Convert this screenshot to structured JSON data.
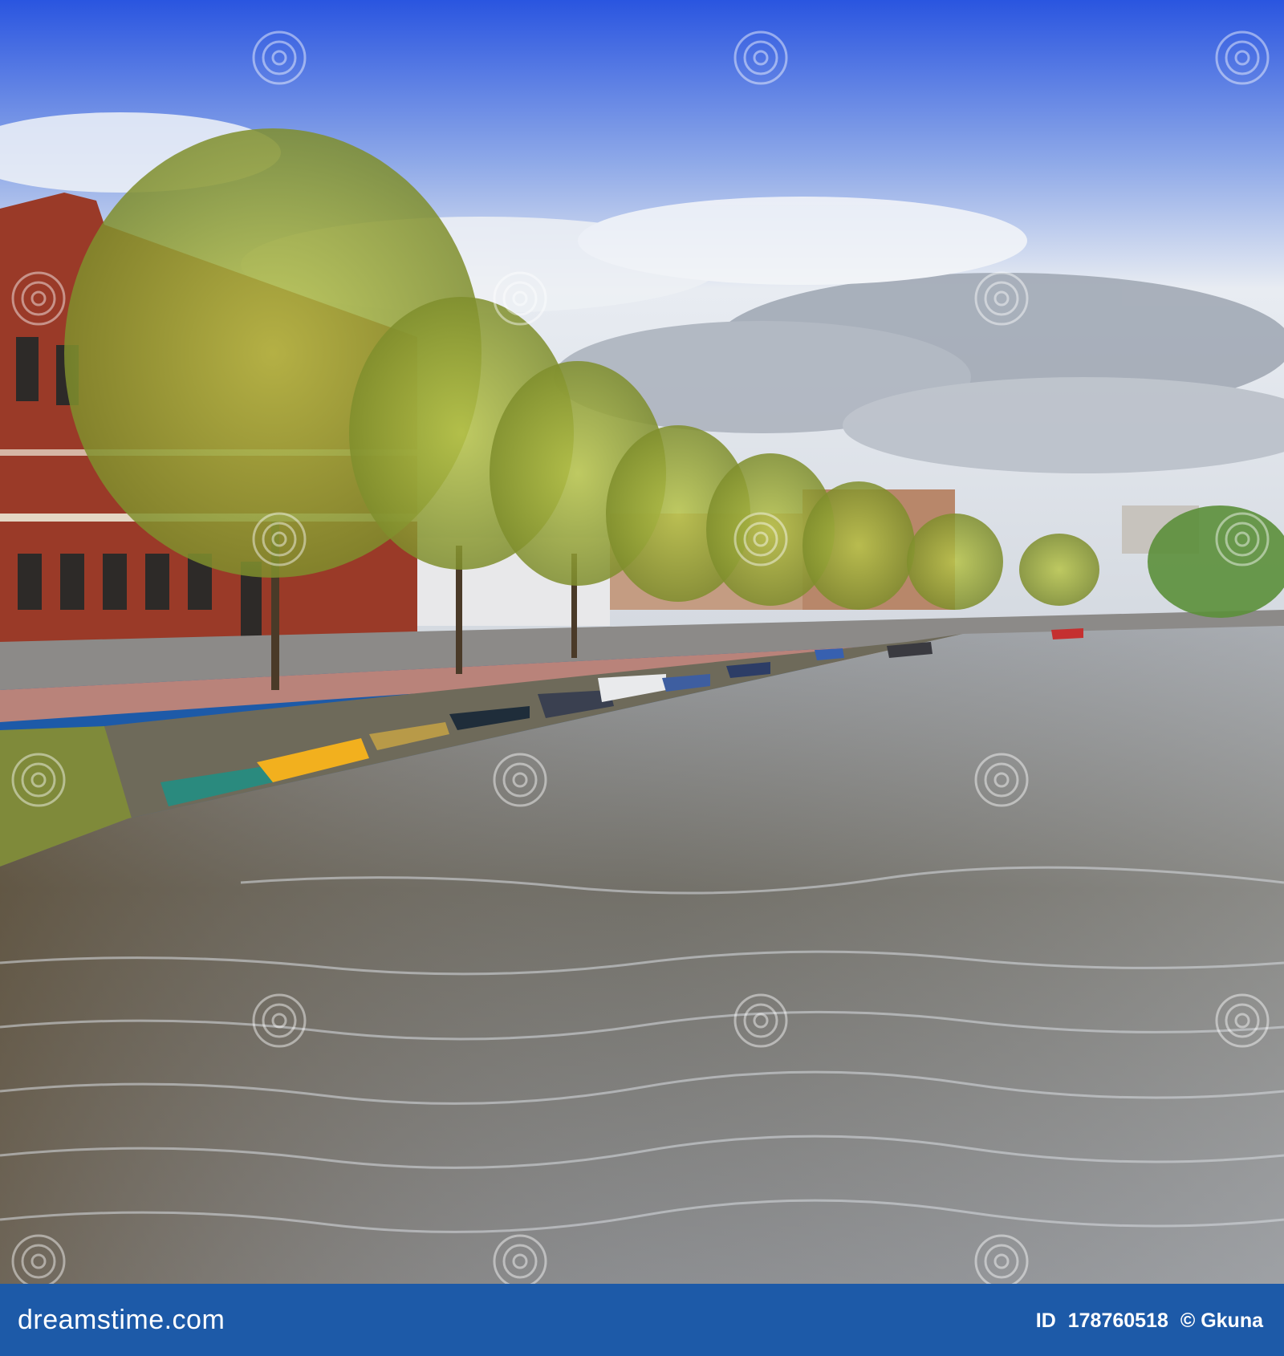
{
  "scene": {
    "subject": "canal with moored boats along a tree-lined quay",
    "colors": {
      "sky_top": "#2f5ee0",
      "sky_bottom": "#dfe6ef",
      "water": "#7a7d80",
      "trees": "#a4b43c",
      "brick": "#9a3a28",
      "boat_yellow": "#f2b01e",
      "boat_teal": "#2a8a7e"
    }
  },
  "watermark": {
    "word": "dreamstime",
    "icon": "spiral-logo-icon"
  },
  "footer": {
    "brand": "dreamstime.com",
    "id_label": "ID",
    "id_value": "178760518",
    "copyright": "© Gkuna",
    "background": "#1d5aa8"
  }
}
